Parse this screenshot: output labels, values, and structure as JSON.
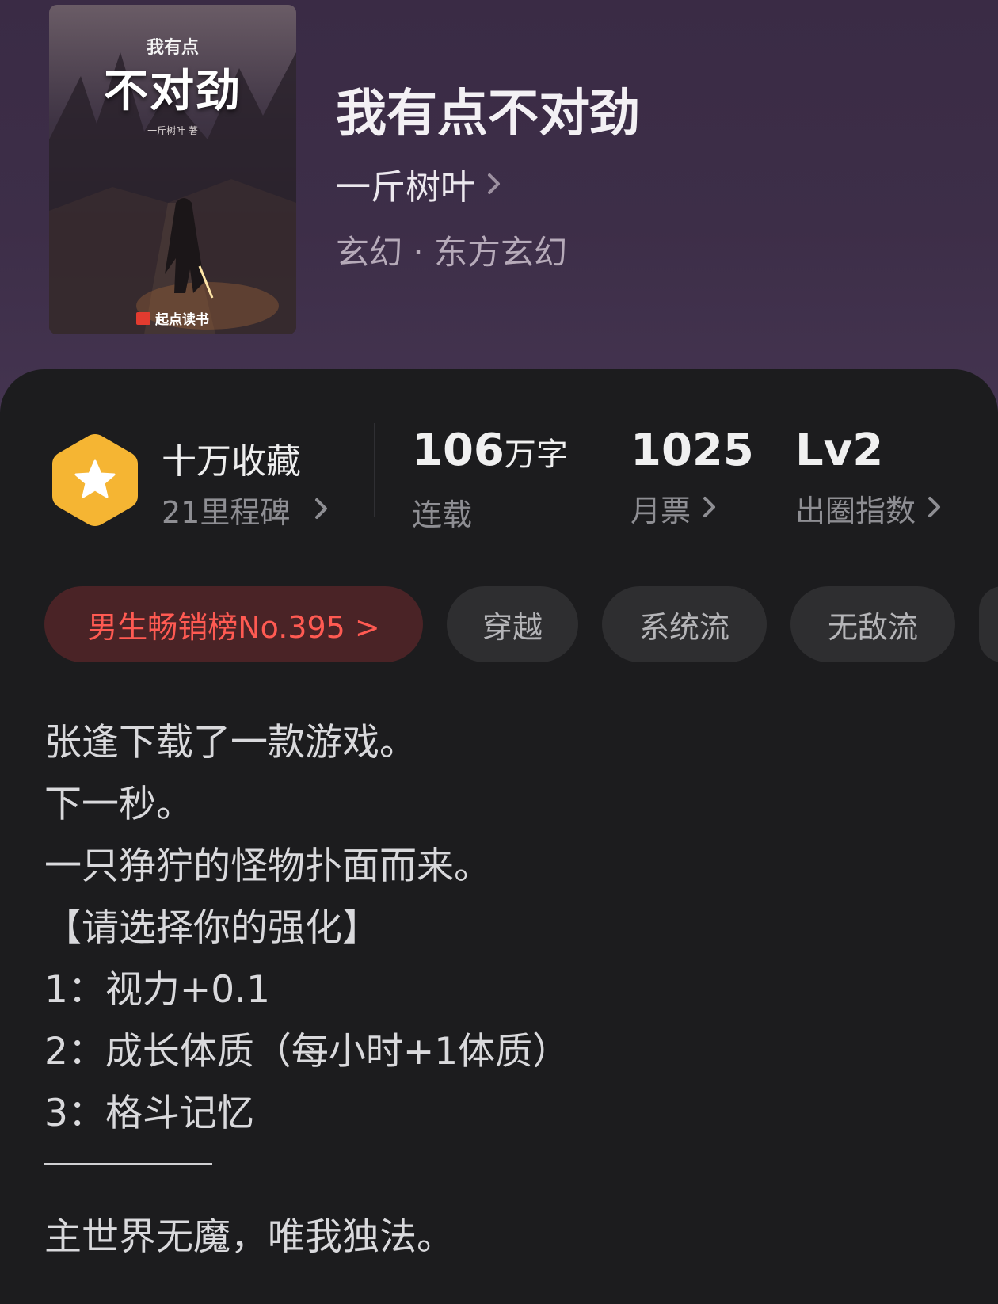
{
  "book": {
    "cover": {
      "subtitle": "我有点",
      "main_title": "不对劲",
      "author_line": "一斤树叶 著",
      "publisher": "起点读书"
    },
    "title": "我有点不对劲",
    "author": "一斤树叶",
    "category": "玄幻 · 东方玄幻"
  },
  "stats": {
    "collection": {
      "title": "十万收藏",
      "subtitle": "21里程碑"
    },
    "words": {
      "value": "106",
      "unit": "万字",
      "label": "连载"
    },
    "monthly_tickets": {
      "value": "1025",
      "label": "月票"
    },
    "circle_index": {
      "value": "Lv2",
      "label": "出圈指数"
    }
  },
  "tags": [
    "男生畅销榜No.395 >",
    "穿越",
    "系统流",
    "无敌流"
  ],
  "description": [
    "张逢下载了一款游戏。",
    "下一秒。",
    "一只狰狞的怪物扑面而来。",
    "【请选择你的强化】",
    "1：视力+0.1",
    "2：成长体质（每小时+1体质）",
    "3：格斗记忆",
    "主世界无魔，唯我独法。"
  ],
  "colors": {
    "header_bg": "#3d2e48",
    "panel_bg": "#1c1c1e",
    "rank_tag_text": "#ff5a52",
    "badge": "#f5b533"
  }
}
